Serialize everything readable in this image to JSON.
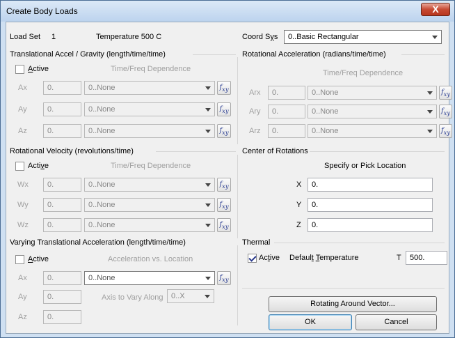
{
  "dialog": {
    "title": "Create Body Loads",
    "close_glyph": "X"
  },
  "header": {
    "load_set_label": "Load Set",
    "load_set_value": "1",
    "load_set_name": "Temperature 500 C",
    "coord_sys_label_pre": "Coord S",
    "coord_sys_label_ul": "y",
    "coord_sys_label_post": "s",
    "coord_sys_value": "0..Basic Rectangular"
  },
  "trans_accel": {
    "title": "Translational Accel / Gravity  (length/time/time)",
    "active_ul": "A",
    "active_rest": "ctive",
    "active_checked": false,
    "dependence_label": "Time/Freq Dependence",
    "rows": [
      {
        "label": "Ax",
        "value": "0.",
        "func": "0..None"
      },
      {
        "label": "Ay",
        "value": "0.",
        "func": "0..None"
      },
      {
        "label": "Az",
        "value": "0.",
        "func": "0..None"
      }
    ]
  },
  "rot_accel": {
    "title": "Rotational Acceleration (radians/time/time)",
    "dependence_label": "Time/Freq Dependence",
    "rows": [
      {
        "label": "Arx",
        "value": "0.",
        "func": "0..None"
      },
      {
        "label": "Ary",
        "value": "0.",
        "func": "0..None"
      },
      {
        "label": "Arz",
        "value": "0.",
        "func": "0..None"
      }
    ]
  },
  "rot_velocity": {
    "title": "Rotational Velocity (revolutions/time)",
    "active_pre": "Acti",
    "active_ul": "v",
    "active_post": "e",
    "active_checked": false,
    "dependence_label": "Time/Freq Dependence",
    "rows": [
      {
        "label": "Wx",
        "value": "0.",
        "func": "0..None"
      },
      {
        "label": "Wy",
        "value": "0.",
        "func": "0..None"
      },
      {
        "label": "Wz",
        "value": "0.",
        "func": "0..None"
      }
    ]
  },
  "center": {
    "title": "Center of Rotations",
    "pick_label": "Specify or Pick Location",
    "rows": [
      {
        "label": "X",
        "value": "0."
      },
      {
        "label": "Y",
        "value": "0."
      },
      {
        "label": "Z",
        "value": "0."
      }
    ]
  },
  "varying": {
    "title": "Varying Translational Acceleration  (length/time/time)",
    "active_ul": "A",
    "active_rest": "ctive",
    "active_checked": false,
    "accel_label": "Acceleration vs. Location",
    "ax_label": "Ax",
    "ax_value": "0.",
    "ax_func": "0..None",
    "ay_label": "Ay",
    "ay_value": "0.",
    "axis_label": "Axis to Vary Along",
    "axis_value": "0..X",
    "az_label": "Az",
    "az_value": "0."
  },
  "thermal": {
    "title": "Thermal",
    "active_pre": "Ac",
    "active_ul": "t",
    "active_post": "ive",
    "active_checked": true,
    "default_temp_pre": "Defaul",
    "default_temp_ul1": "t",
    "default_temp_mid": " ",
    "default_temp_ul2": "T",
    "default_temp_post": "emperature",
    "t_label": "T",
    "t_value": "500."
  },
  "buttons": {
    "rotating": "Rotating Around Vector...",
    "ok": "OK",
    "cancel": "Cancel"
  }
}
